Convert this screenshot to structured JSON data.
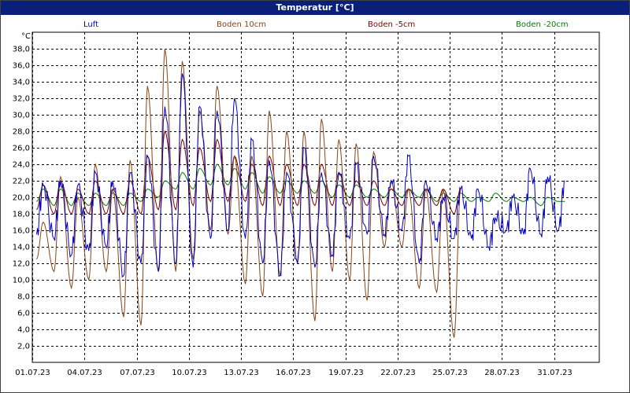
{
  "window": {
    "title": "Temperatur [°C]"
  },
  "colors": {
    "Luft": "#0000c8",
    "Boden 10cm": "#8b4513",
    "Boden -5cm": "#800000",
    "Boden -20cm": "#008000"
  },
  "chart_data": {
    "type": "line",
    "title": "Temperatur [°C]",
    "ylabel": "°C",
    "ylim": [
      0,
      40
    ],
    "yticks": [
      2,
      4,
      6,
      8,
      10,
      12,
      14,
      16,
      18,
      20,
      22,
      24,
      26,
      28,
      30,
      32,
      34,
      36,
      38
    ],
    "ytick_labels": [
      "2,0",
      "4,0",
      "6,0",
      "8,0",
      "10,0",
      "12,0",
      "14,0",
      "16,0",
      "18,0",
      "20,0",
      "22,0",
      "24,0",
      "26,0",
      "28,0",
      "30,0",
      "32,0",
      "34,0",
      "36,0",
      "38,0"
    ],
    "xlim": [
      1,
      33.6
    ],
    "xticks": [
      1,
      4,
      7,
      10,
      13,
      16,
      19,
      22,
      25,
      28,
      31
    ],
    "xtick_labels": [
      "01.07.23",
      "04.07.23",
      "07.07.23",
      "10.07.23",
      "13.07.23",
      "16.07.23",
      "19.07.23",
      "22.07.23",
      "25.07.23",
      "28.07.23",
      "31.07.23"
    ],
    "grid": true,
    "legend_position": "top",
    "series": [
      {
        "name": "Luft",
        "min": [
          15.5,
          15,
          13,
          13.5,
          14,
          10.5,
          12,
          11,
          12,
          11.5,
          15,
          16,
          15,
          12,
          10.5,
          12,
          11.5,
          13,
          15,
          15.5,
          15.5,
          16,
          12,
          15,
          15,
          15,
          14,
          16,
          15.5,
          15.5,
          16
        ],
        "max": [
          21.5,
          22,
          21.5,
          23,
          22,
          23,
          25,
          31,
          35,
          31,
          30.5,
          32,
          27,
          24.5,
          23,
          26,
          23,
          23,
          24,
          25,
          22,
          25,
          22,
          20,
          21,
          21,
          17.5,
          20,
          23.5,
          22.5,
          22
        ]
      },
      {
        "name": "Boden 10cm",
        "min": [
          12.5,
          11,
          9,
          10,
          11,
          5.5,
          4.5,
          11,
          11,
          12.5,
          16,
          15.5,
          9.5,
          8,
          10.5,
          12,
          5,
          11,
          10,
          7.5,
          14,
          14,
          9,
          8.5,
          3
        ]
      },
      {
        "name": "Boden 10cm",
        "max": [
          17,
          22.5,
          20,
          24,
          21,
          24.5,
          33.5,
          38,
          36.5,
          30.5,
          33.5,
          25,
          25,
          30.5,
          28,
          28,
          29.5,
          27,
          26.5,
          25.5,
          22,
          21,
          21,
          21,
          21
        ]
      },
      {
        "name": "Boden -5cm",
        "min": [
          18.5,
          18,
          18,
          18,
          18,
          18,
          18,
          18.5,
          18.5,
          19,
          19.5,
          19.5,
          19.5,
          19,
          19,
          19,
          19,
          19,
          19,
          19,
          19,
          19,
          19,
          19,
          18
        ]
      },
      {
        "name": "Boden -5cm",
        "max": [
          21.5,
          22,
          21,
          22,
          21,
          22,
          25,
          28,
          27,
          26,
          27,
          25,
          24,
          25,
          24,
          24,
          24,
          23,
          22,
          22,
          21,
          21,
          21,
          21,
          21
        ]
      },
      {
        "name": "Boden -20cm",
        "min": [
          19.5,
          19,
          19,
          19,
          19,
          19,
          19.5,
          20,
          21,
          21,
          21.5,
          21.5,
          21,
          20.5,
          20.5,
          20.5,
          20.5,
          20,
          20,
          20,
          20,
          20,
          20,
          19.5,
          19.5,
          19.5,
          19.5,
          19.5,
          19.5,
          19,
          19.5
        ]
      },
      {
        "name": "Boden -20cm",
        "max": [
          21,
          21,
          20.5,
          20.5,
          20.5,
          20.5,
          21,
          22,
          23,
          23.5,
          24,
          23.5,
          23,
          22.5,
          22,
          22,
          22,
          21.5,
          21.5,
          21,
          21,
          21,
          21,
          20.5,
          20.5,
          20,
          20.5,
          20,
          20,
          20,
          19.5
        ]
      }
    ]
  }
}
